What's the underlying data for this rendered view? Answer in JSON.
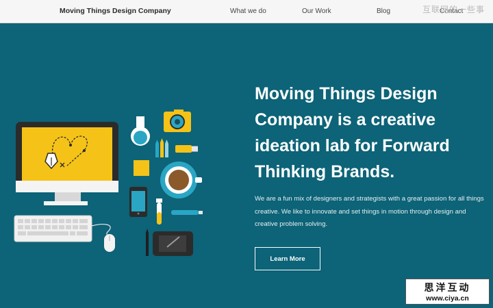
{
  "nav": {
    "brand": "Moving Things Design Company",
    "links": [
      "What we do",
      "Our Work",
      "Blog",
      "Contact"
    ]
  },
  "hero": {
    "headline": "Moving Things Design Company is a creative ideation lab for Forward Thinking Brands.",
    "description": "We are a fun mix of designers and strategists with a great passion for all things creative. We like to innovate and set things in motion through design and creative problem solving.",
    "cta_label": "Learn More"
  },
  "watermark": {
    "top_text": "互联网的一些事",
    "badge_cn": "思洋互动",
    "badge_url": "www.ciya.cn"
  },
  "colors": {
    "hero_background": "#0d6377",
    "nav_background": "#f6f6f6",
    "screen_yellow": "#f5c218",
    "accent_teal": "#2aa6c4"
  }
}
